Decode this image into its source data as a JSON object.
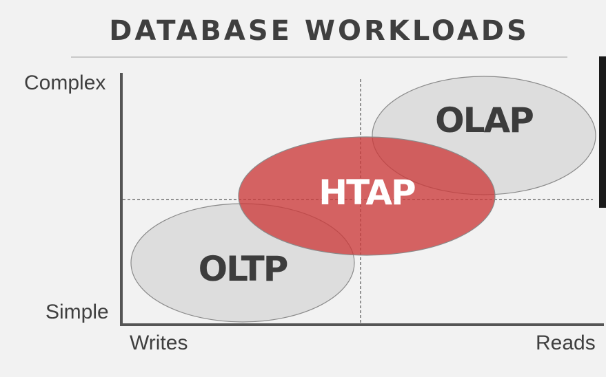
{
  "title": "DATABASE WORKLOADS",
  "axes": {
    "y_top": "Complex",
    "y_bottom": "Simple",
    "x_left": "Writes",
    "x_right": "Reads"
  },
  "regions": [
    {
      "label": "OLTP",
      "fill": "#d9d9d9",
      "label_color": "#3c3c3c"
    },
    {
      "label": "OLAP",
      "fill": "#d9d9d9",
      "label_color": "#3c3c3c"
    },
    {
      "label": "HTAP",
      "fill": "#cc3a3a",
      "label_color": "#ffffff"
    }
  ],
  "colors": {
    "axis": "#555555",
    "background": "#f2f2f2"
  }
}
